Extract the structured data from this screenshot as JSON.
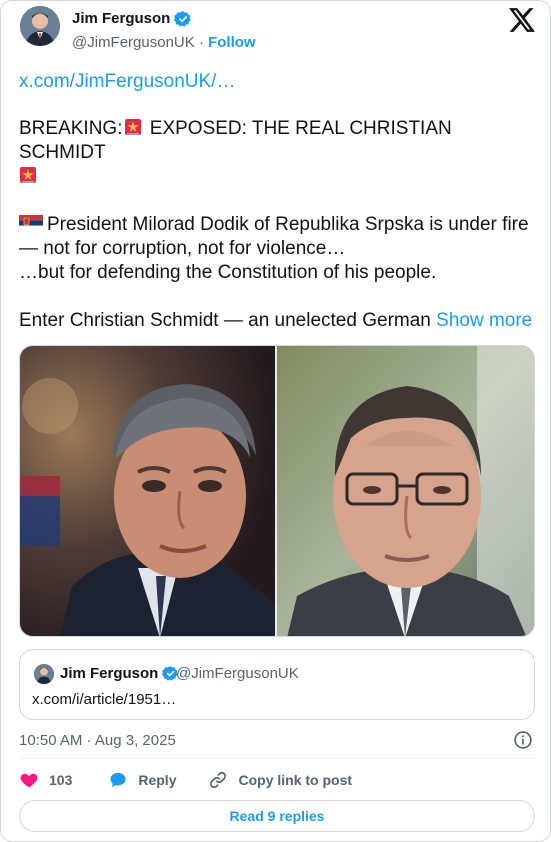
{
  "author": {
    "name": "Jim Ferguson",
    "handle": "@JimFergusonUK",
    "separator": "·",
    "follow_label": "Follow"
  },
  "post": {
    "link": "x.com/JimFergusonUK/…",
    "breaking_prefix": "BREAKING:",
    "breaking_title": "EXPOSED: THE REAL CHRISTIAN SCHMIDT",
    "line1": "President Milorad Dodik of Republika Srpska is under fire — not for corruption, not for violence…",
    "line2": "…but for defending the Constitution of his people.",
    "line3": "Enter Christian Schmidt — an unelected German",
    "show_more": "Show more"
  },
  "quote": {
    "name": "Jim Ferguson",
    "handle": "@JimFergusonUK",
    "link": "x.com/i/article/1951…"
  },
  "meta": {
    "time": "10:50 AM · Aug 3, 2025"
  },
  "actions": {
    "like_count": "103",
    "reply_label": "Reply",
    "copy_label": "Copy link to post"
  },
  "replies_button": "Read 9 replies",
  "colors": {
    "accent": "#1d9bf0",
    "like": "#f91880",
    "text": "#0f1419",
    "secondary": "#536471"
  },
  "icons": [
    "x-logo-icon",
    "verified-badge-icon",
    "siren-icon",
    "serbia-flag-icon",
    "info-icon",
    "heart-icon",
    "reply-bubble-icon",
    "link-icon"
  ]
}
